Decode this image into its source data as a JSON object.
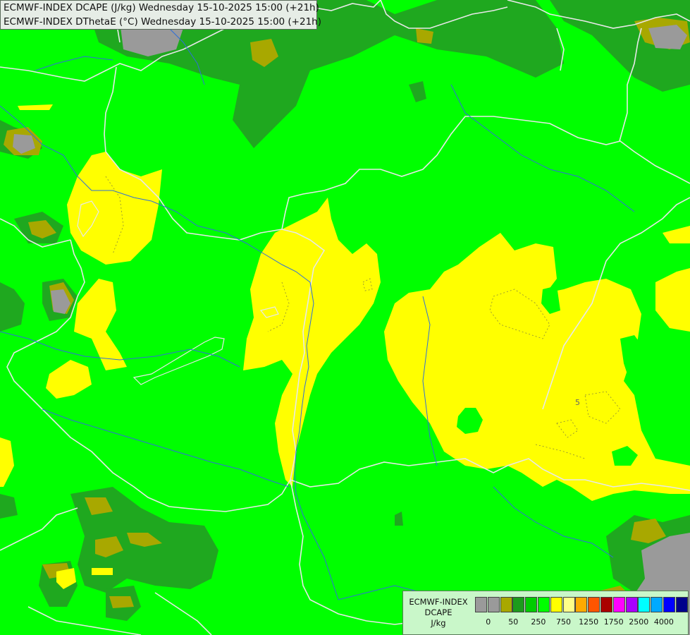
{
  "title": {
    "line1": "ECMWF-INDEX DCAPE (J/kg) Wednesday 15-10-2025 15:00 (+21h)",
    "line2": "ECMWF-INDEX DThetaE (°C) Wednesday 15-10-2025 15:00 (+21h)"
  },
  "map": {
    "contour_label": "5"
  },
  "legend": {
    "line1": "ECMWF-INDEX",
    "line2": "DCAPE",
    "line3": "J/kg",
    "colors": [
      "#9a9a9a",
      "#9a9a9a",
      "#a8a800",
      "#1c9b1c",
      "#00cc00",
      "#00ff00",
      "#ffff00",
      "#ffff88",
      "#ffaa00",
      "#ff5500",
      "#aa0000",
      "#ff00ff",
      "#aa00ff",
      "#00ffff",
      "#00aaff",
      "#0000ff",
      "#00008b"
    ],
    "ticks": [
      "0",
      "50",
      "250",
      "750",
      "1250",
      "1750",
      "2500",
      "4000"
    ]
  }
}
